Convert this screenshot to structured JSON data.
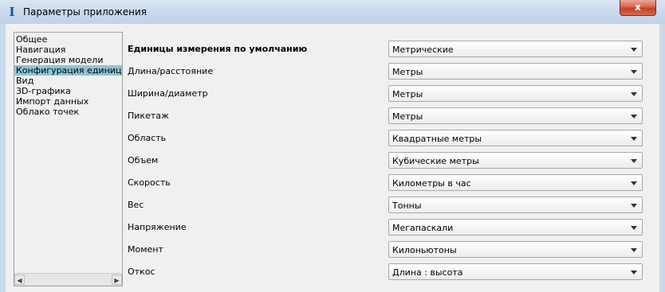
{
  "window": {
    "title": "Параметры приложения",
    "close_glyph": "x",
    "icon": "app-logo-icon"
  },
  "nav": {
    "items": [
      {
        "label": "Общее"
      },
      {
        "label": "Навигация"
      },
      {
        "label": "Генерация модели"
      },
      {
        "label": "Конфигурация единиц измерения",
        "selected": true
      },
      {
        "label": "Вид"
      },
      {
        "label": "3D-графика"
      },
      {
        "label": "Импорт данных"
      },
      {
        "label": "Облако точек"
      }
    ],
    "scroll_left_glyph": "◀",
    "scroll_right_glyph": "▶"
  },
  "units": {
    "header_label": "Единицы измерения по умолчанию",
    "header_value": "Метрические",
    "rows": [
      {
        "label": "Длина/расстояние",
        "value": "Метры"
      },
      {
        "label": "Ширина/диаметр",
        "value": "Метры"
      },
      {
        "label": "Пикетаж",
        "value": "Метры"
      },
      {
        "label": "Область",
        "value": "Квадратные метры"
      },
      {
        "label": "Объем",
        "value": "Кубические метры"
      },
      {
        "label": "Скорость",
        "value": "Километры в час"
      },
      {
        "label": "Вес",
        "value": "Тонны"
      },
      {
        "label": "Напряжение",
        "value": "Мегапаскали"
      },
      {
        "label": "Момент",
        "value": "Килоньютоны"
      },
      {
        "label": "Откос",
        "value": "Длина : высота"
      }
    ]
  }
}
